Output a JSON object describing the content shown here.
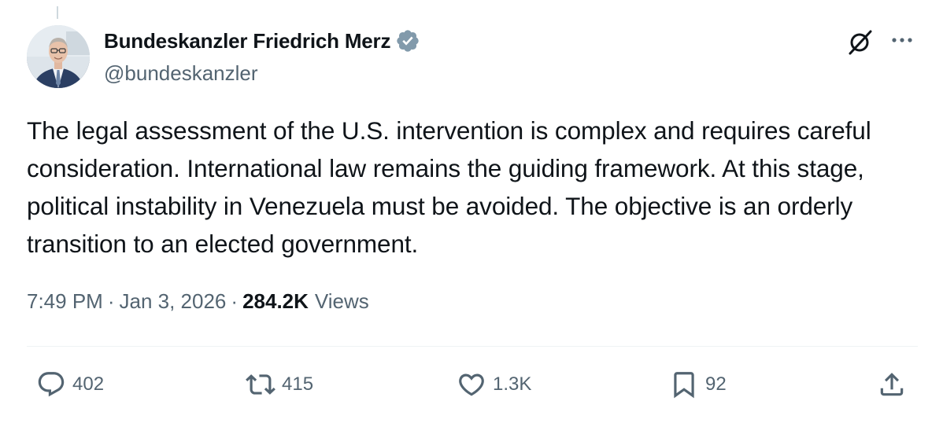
{
  "author": {
    "display_name": "Bundeskanzler Friedrich Merz",
    "handle": "@bundeskanzler",
    "verified_badge_color": "#829aab"
  },
  "header_actions": {
    "grok_icon": "grok-slash-icon",
    "more_icon": "more-horizontal-icon"
  },
  "tweet": {
    "text": "The legal assessment of the U.S. intervention is complex and requires careful consideration. International law remains the guiding framework. At this stage, political instability in Venezuela must be avoided. The objective is an orderly transition to an elected government.",
    "time": "7:49 PM",
    "separator": "·",
    "date": "Jan 3, 2026",
    "views_count": "284.2K",
    "views_label": "Views"
  },
  "actions": {
    "replies": "402",
    "reposts": "415",
    "likes": "1.3K",
    "bookmarks": "92"
  },
  "colors": {
    "primary_text": "#0f1419",
    "secondary_text": "#536471",
    "divider": "#eff3f4"
  }
}
